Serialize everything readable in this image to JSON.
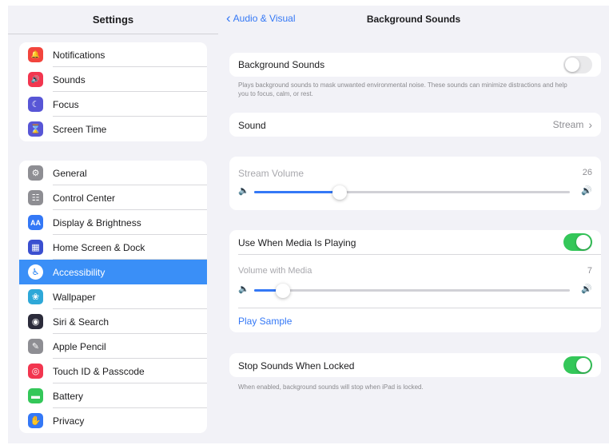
{
  "sidebar": {
    "title": "Settings",
    "group1": [
      {
        "label": "Notifications",
        "icon": "bell-icon",
        "color": "#f2453d",
        "glyph": "🔔"
      },
      {
        "label": "Sounds",
        "icon": "speaker-icon",
        "color": "#f2364f",
        "glyph": "🔊"
      },
      {
        "label": "Focus",
        "icon": "moon-icon",
        "color": "#5856d6",
        "glyph": "☾"
      },
      {
        "label": "Screen Time",
        "icon": "hourglass-icon",
        "color": "#5856d6",
        "glyph": "⌛"
      }
    ],
    "group2": [
      {
        "label": "General",
        "icon": "gear-icon",
        "color": "#8e8e93",
        "glyph": "⚙"
      },
      {
        "label": "Control Center",
        "icon": "control-center-icon",
        "color": "#8e8e93",
        "glyph": "☷"
      },
      {
        "label": "Display & Brightness",
        "icon": "display-icon",
        "color": "#3478f6",
        "glyph": "AA"
      },
      {
        "label": "Home Screen & Dock",
        "icon": "home-screen-icon",
        "color": "#3a4fd0",
        "glyph": "▦"
      },
      {
        "label": "Accessibility",
        "icon": "accessibility-icon",
        "color": "#1a7cf2",
        "glyph": "♿",
        "selected": true
      },
      {
        "label": "Wallpaper",
        "icon": "wallpaper-icon",
        "color": "#2ea8d8",
        "glyph": "❀"
      },
      {
        "label": "Siri & Search",
        "icon": "siri-icon",
        "color": "#2b2b3a",
        "glyph": "◉"
      },
      {
        "label": "Apple Pencil",
        "icon": "pencil-icon",
        "color": "#8e8e93",
        "glyph": "✎"
      },
      {
        "label": "Touch ID & Passcode",
        "icon": "fingerprint-icon",
        "color": "#f2364f",
        "glyph": "◎"
      },
      {
        "label": "Battery",
        "icon": "battery-icon",
        "color": "#34c759",
        "glyph": "▬"
      },
      {
        "label": "Privacy",
        "icon": "hand-icon",
        "color": "#3478f6",
        "glyph": "✋"
      }
    ]
  },
  "header": {
    "back_label": "Audio & Visual",
    "title": "Background Sounds"
  },
  "background_sounds": {
    "label": "Background Sounds",
    "enabled": false,
    "footnote": "Plays background sounds to mask unwanted environmental noise. These sounds can minimize distractions and help you to focus, calm, or rest."
  },
  "sound": {
    "label": "Sound",
    "value": "Stream",
    "chevron": "›"
  },
  "stream_volume": {
    "label": "Stream Volume",
    "value": "26",
    "level": 0.27
  },
  "media": {
    "label": "Use When Media Is Playing",
    "enabled": true,
    "volume_label": "Volume with Media",
    "volume_value": "7",
    "level": 0.09,
    "play_sample": "Play Sample"
  },
  "locked": {
    "label": "Stop Sounds When Locked",
    "enabled": true,
    "footnote": "When enabled, background sounds will stop when iPad is locked."
  },
  "colors": {
    "accent": "#3478f6",
    "toggle_on": "#34c759",
    "selected_row": "#3a8ff7"
  }
}
